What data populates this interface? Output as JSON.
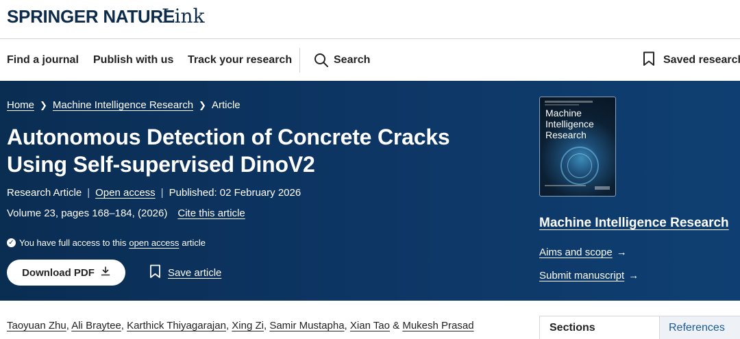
{
  "brand": {
    "logo": "SPRINGER NATURE",
    "product": "Link"
  },
  "nav": {
    "items": [
      "Find a journal",
      "Publish with us",
      "Track your research"
    ],
    "search_label": "Search",
    "saved_label": "Saved research"
  },
  "breadcrumb": [
    "Home",
    "Machine Intelligence Research",
    "Article"
  ],
  "article": {
    "title": "Autonomous Detection of Concrete Cracks Using Self-supervised DinoV2",
    "type": "Research Article",
    "access": "Open access",
    "published": "Published: 02 February 2026",
    "volume": "Volume 23, pages 168–184, (2026)",
    "cite": "Cite this article",
    "access_note_pre": "You have full access to this",
    "access_note_link": "open access",
    "access_note_post": "article",
    "download_label": "Download PDF",
    "save_label": "Save article"
  },
  "journal": {
    "cover_title": "Machine Intelligence Research",
    "name": "Machine Intelligence Research",
    "aims": "Aims and scope",
    "submit": "Submit manuscript"
  },
  "authors": [
    "Taoyuan Zhu",
    "Ali Braytee",
    "Karthick Thiyagarajan",
    "Xing Zi",
    "Samir Mustapha",
    "Xian Tao",
    "Mukesh Prasad"
  ],
  "author_separators": [
    ", ",
    ", ",
    ", ",
    ", ",
    ", ",
    " & "
  ],
  "tabs": {
    "sections": "Sections",
    "references": "References"
  },
  "colors": {
    "hero": "#0d3563",
    "brand": "#0c2b4b",
    "link_blue": "#1a5a96"
  }
}
